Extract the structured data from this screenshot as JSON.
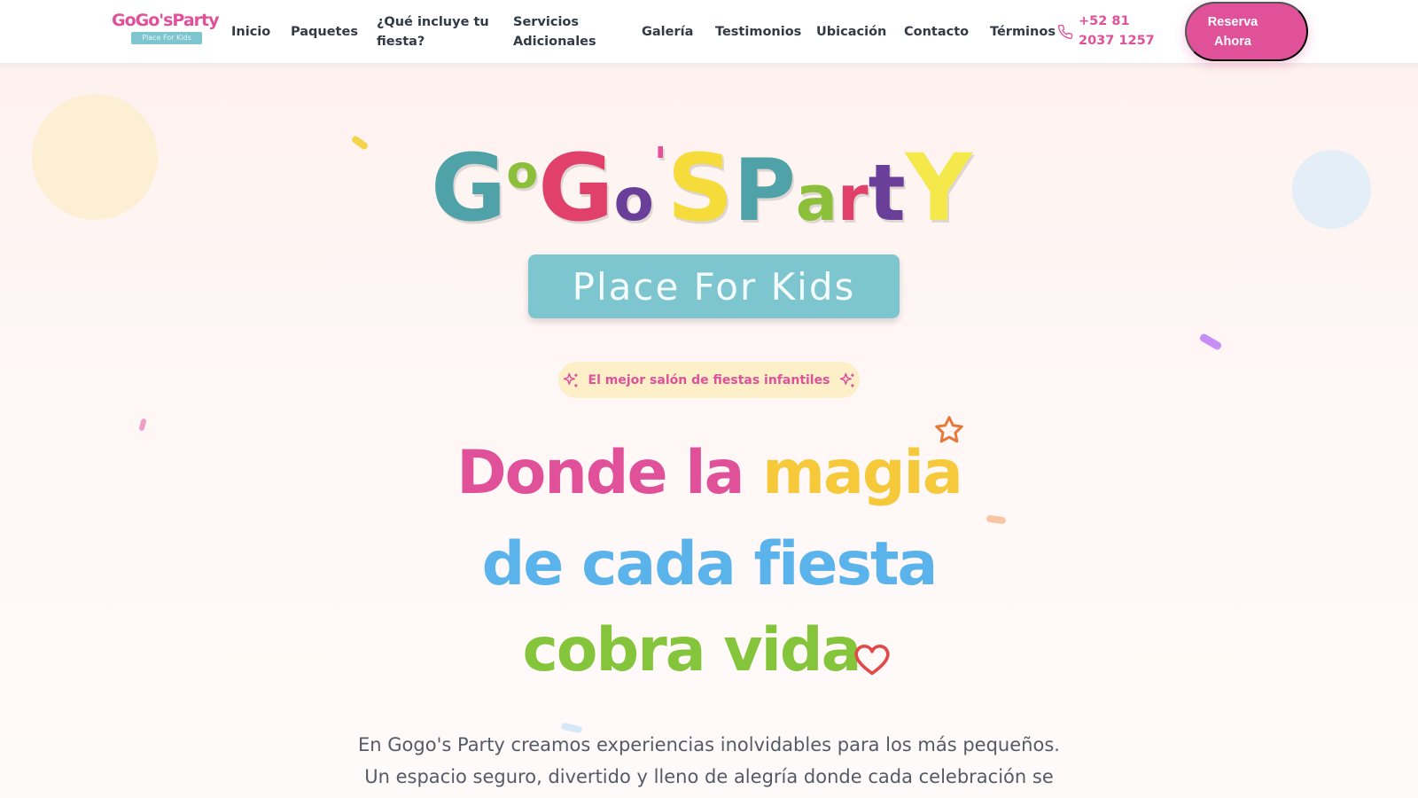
{
  "nav": {
    "logo": {
      "word": "GoGo'sParty",
      "tag": "Place For Kids"
    },
    "items": [
      {
        "label": "Inicio"
      },
      {
        "label": "Paquetes"
      },
      {
        "label": "¿Qué incluye tu fiesta?"
      },
      {
        "label": "Servicios Adicionales"
      },
      {
        "label": "Galería"
      },
      {
        "label": "Testimonios"
      },
      {
        "label": "Ubicación"
      },
      {
        "label": "Contacto"
      },
      {
        "label": "Términos"
      }
    ],
    "phone": "+52 81 2037 1257",
    "phone_icon": "phone-icon",
    "cta": "Reserva Ahora"
  },
  "hero": {
    "logo_title": "GoGo'sParty",
    "logo_subtitle": "Place For Kids",
    "badge": "El mejor salón de fiestas infantiles",
    "badge_icon": "sparkles-icon",
    "headline": {
      "line1_a": "Donde la ",
      "line1_b": "magia",
      "line2": "de cada fiesta",
      "line3": "cobra vida"
    },
    "description_line1": "En Gogo's Party creamos experiencias inolvidables para los más pequeños.",
    "description_line2": "Un espacio seguro, divertido y lleno de alegría donde cada celebración se"
  },
  "colors": {
    "brand_pink": "#e0519a",
    "yellow": "#f5c93a",
    "blue": "#5bb3ec",
    "green": "#84c53c",
    "teal": "#7ec6cf"
  }
}
